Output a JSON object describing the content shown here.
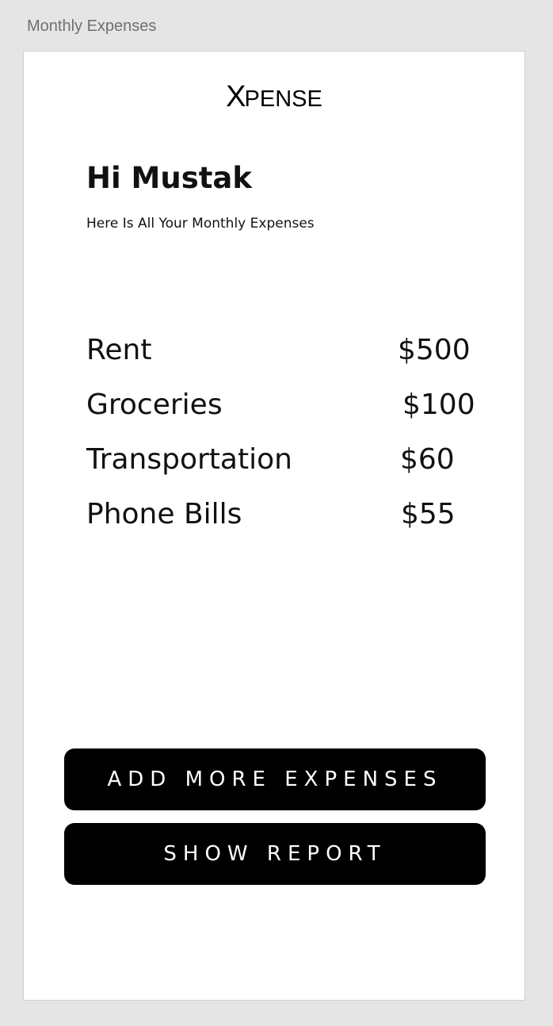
{
  "frame": {
    "label": "Monthly Expenses"
  },
  "header": {
    "logo_x": "X",
    "logo_rest": "PENSE"
  },
  "greeting": {
    "title": "Hi Mustak",
    "subtitle": "Here Is All Your Monthly Expenses"
  },
  "expenses": [
    {
      "name": "Rent",
      "amount": "$500"
    },
    {
      "name": "Groceries",
      "amount": "$100"
    },
    {
      "name": "Transportation",
      "amount": "$60"
    },
    {
      "name": "Phone Bills",
      "amount": "$55"
    }
  ],
  "actions": {
    "add_label": "ADD MORE EXPENSES",
    "report_label": "SHOW REPORT"
  },
  "colors": {
    "background": "#e5e5e5",
    "card": "#ffffff",
    "button": "#000000",
    "button_text": "#ffffff",
    "text": "#111111"
  }
}
